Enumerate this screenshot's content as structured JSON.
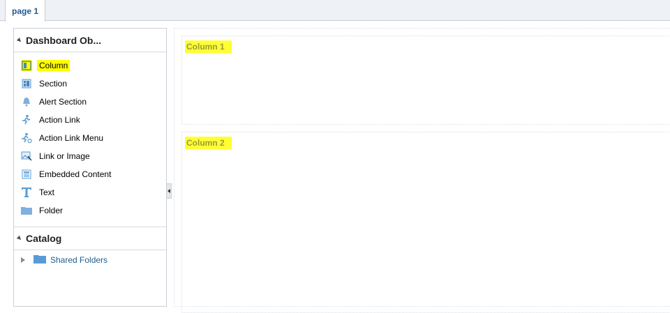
{
  "tabs": [
    {
      "label": "page 1"
    }
  ],
  "left_panel": {
    "title": "Dashboard Ob...",
    "objects": [
      {
        "label": "Column",
        "icon": "column-icon"
      },
      {
        "label": "Section",
        "icon": "section-icon"
      },
      {
        "label": "Alert Section",
        "icon": "alert-bell-icon"
      },
      {
        "label": "Action Link",
        "icon": "action-link-icon"
      },
      {
        "label": "Action Link Menu",
        "icon": "action-link-menu-icon"
      },
      {
        "label": "Link or Image",
        "icon": "link-image-icon"
      },
      {
        "label": "Embedded Content",
        "icon": "embedded-content-icon"
      },
      {
        "label": "Text",
        "icon": "text-icon"
      },
      {
        "label": "Folder",
        "icon": "folder-icon"
      }
    ],
    "catalog_title": "Catalog",
    "catalog_items": [
      {
        "label": "Shared Folders",
        "icon": "folder-icon"
      }
    ]
  },
  "canvas": {
    "columns": [
      {
        "label": "Column 1"
      },
      {
        "label": "Column 2"
      }
    ]
  },
  "colors": {
    "link_blue": "#1f5b91",
    "highlight": "#ffff00",
    "icon_blue": "#5a9bd5"
  }
}
